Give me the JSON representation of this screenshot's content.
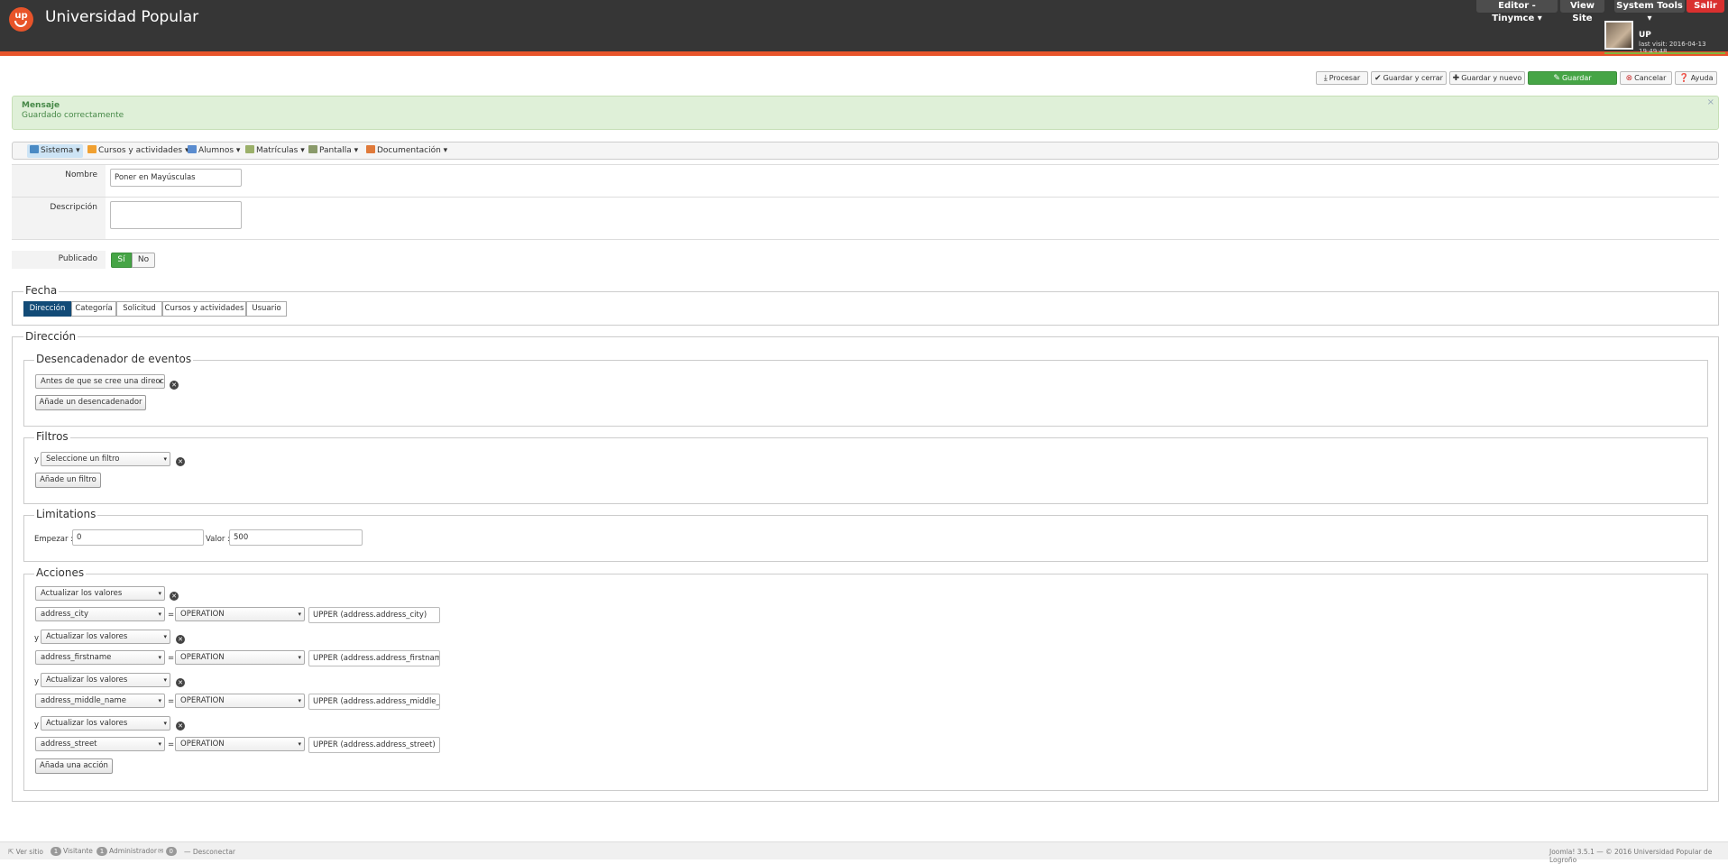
{
  "header": {
    "logo_text": "up",
    "title": "Universidad Popular",
    "top_buttons": {
      "editor": "Editor - Tinymce",
      "view_site": "View Site",
      "system_tools": "System Tools",
      "logout": "Salir"
    },
    "user": {
      "name": "UP",
      "last_visit": "last visit: 2016-04-13 19:49:48"
    }
  },
  "toolbar": {
    "process": "Procesar",
    "save_close": "Guardar y cerrar",
    "save_new": "Guardar y nuevo",
    "save": "Guardar",
    "cancel": "Cancelar",
    "help": "Ayuda"
  },
  "alert": {
    "title": "Mensaje",
    "message": "Guardado correctamente",
    "close": "×"
  },
  "menu": [
    "Sistema",
    "Cursos y actividades",
    "Alumnos",
    "Matrículas",
    "Pantalla",
    "Documentación"
  ],
  "form": {
    "name_label": "Nombre",
    "name_value": "Poner en Mayúsculas",
    "description_label": "Descripción",
    "published_label": "Publicado",
    "yes": "Sí",
    "no": "No"
  },
  "fecha": {
    "legend": "Fecha",
    "tabs": [
      "Dirección",
      "Categoría",
      "Solicitud",
      "Cursos y actividades",
      "Usuario"
    ]
  },
  "direccion": {
    "legend": "Dirección",
    "triggers": {
      "legend": "Desencadenador de eventos",
      "select_value": "Antes de que se cree una direcc",
      "add_button": "Añade un desencadenador"
    },
    "filters": {
      "legend": "Filtros",
      "and": "y",
      "select_value": "Seleccione un filtro",
      "add_button": "Añade un filtro"
    },
    "limitations": {
      "legend": "Limitations",
      "start_label": "Empezar :",
      "start_value": "0",
      "value_label": "Valor :",
      "value_value": "500"
    },
    "actions": {
      "legend": "Acciones",
      "and": "y",
      "equals": "=",
      "items": [
        {
          "action": "Actualizar los valores",
          "field": "address_city",
          "op": "OPERATION",
          "expr": "UPPER (address.address_city)"
        },
        {
          "action": "Actualizar los valores",
          "field": "address_firstname",
          "op": "OPERATION",
          "expr": "UPPER (address.address_firstname)"
        },
        {
          "action": "Actualizar los valores",
          "field": "address_middle_name",
          "op": "OPERATION",
          "expr": "UPPER (address.address_middle_name)"
        },
        {
          "action": "Actualizar los valores",
          "field": "address_street",
          "op": "OPERATION",
          "expr": "UPPER (address.address_street)"
        }
      ],
      "add_button": "Añada una acción"
    }
  },
  "footer": {
    "view_site": "Ver sitio",
    "visitors_count": "1",
    "visitors": "Visitante",
    "admins_count": "1",
    "admins": "Administrador",
    "messages_count": "0",
    "logout": "Desconectar",
    "copyright": "Joomla! 3.5.1 — © 2016 Universidad Popular de Logroño"
  },
  "colors": {
    "accent": "#e8542a",
    "header_bg": "#363636",
    "success": "#46a546",
    "tab_active": "#124b77",
    "alert_bg": "#dff0d8"
  }
}
